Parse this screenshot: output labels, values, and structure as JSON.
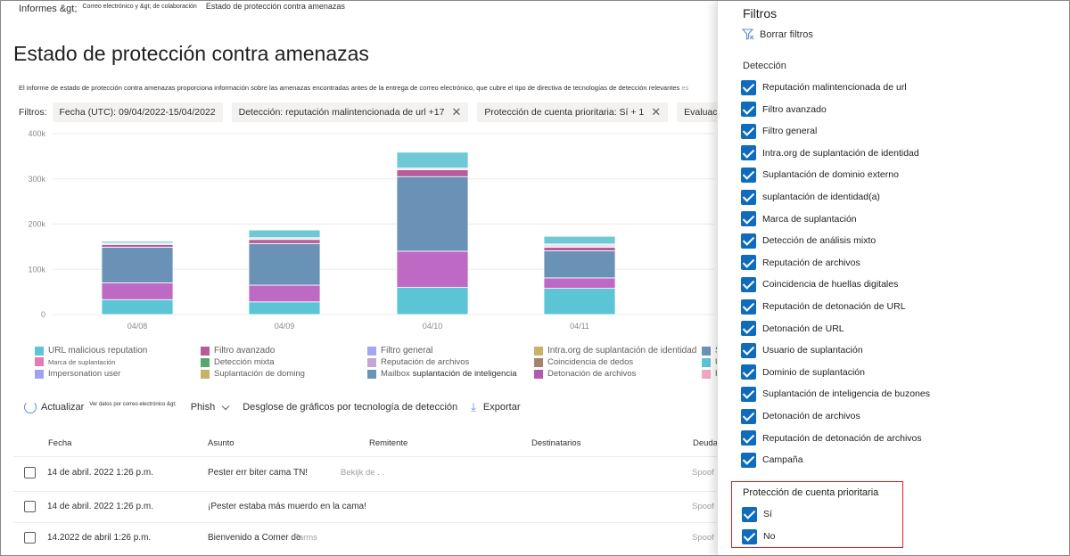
{
  "breadcrumb": {
    "item1": "Informes &gt;",
    "item2": "Correo electrónico y &gt; de colaboración",
    "item3": "Estado de protección contra amenazas"
  },
  "page_title": "Estado de protección contra amenazas",
  "description": {
    "text": "El informe de estado de protección contra amenazas proporciona información sobre las amenazas encontradas antes de la entrega de correo electrónico, que cubre el tipo de directiva de tecnologías de detección relevantes",
    "fade": "es"
  },
  "filters": {
    "label": "Filtros:",
    "chips": [
      {
        "text": "Fecha (UTC): 09/04/2022-15/04/2022"
      },
      {
        "text": "Detección: reputación malintencionada de url +17"
      },
      {
        "text": "Protección de cuenta prioritaria: Sí + 1"
      },
      {
        "text": "Evaluación: NO"
      }
    ]
  },
  "chart_data": {
    "type": "bar",
    "stacked": true,
    "categories": [
      "04/08",
      "04/09",
      "04/10",
      "04/11"
    ],
    "y_ticks": [
      "0",
      "100k",
      "200k",
      "300k",
      "400k"
    ],
    "ylim": [
      0,
      400000
    ],
    "series": [
      {
        "name": "URL malicious reputation",
        "color": "#5bc5d6",
        "values": [
          33000,
          28000,
          60000,
          58000
        ]
      },
      {
        "name": "Filtro avanzado",
        "color": "#be69c4",
        "values": [
          37000,
          37000,
          80000,
          23000
        ]
      },
      {
        "name": "Impersonation user",
        "color": "#6a92b7",
        "values": [
          79000,
          92000,
          165000,
          60000
        ]
      },
      {
        "name": "Marca de suplantación",
        "color": "#b85b9a",
        "values": [
          6000,
          9000,
          15000,
          8000
        ]
      },
      {
        "name": "Filtro general",
        "color": "#ece3f0",
        "values": [
          3000,
          4000,
          4000,
          7000
        ]
      },
      {
        "name": "Suplantación de dominio",
        "color": "#6ec8d5",
        "values": [
          4000,
          17000,
          35000,
          17000
        ]
      }
    ]
  },
  "legend": [
    {
      "label": "URL malicious reputation",
      "color": "#5bc5d6"
    },
    {
      "label": "Filtro avanzado",
      "color": "#b85b9a"
    },
    {
      "label": "Filtro general",
      "color": "#a3a6f2"
    },
    {
      "label": "Intra.org de suplantación de identidad",
      "color": "#c9b16a"
    },
    {
      "label": "Marca de suplantación",
      "color": "#e67ab6"
    },
    {
      "label": "Detección mixta",
      "color": "#55a86a"
    },
    {
      "label": "Reputación de archivos",
      "color": "#c3a6d6"
    },
    {
      "label": "Coincidencia de dedos",
      "color": "#a5836b"
    },
    {
      "label": "Impersonation user",
      "color": "#9fa2f0"
    },
    {
      "label": "Suplantación de doming",
      "color": "#c9b16a"
    },
    {
      "label": "Mailbox",
      "label2": "suplantación de inteligencia",
      "color": "#6a92b7"
    },
    {
      "label": "Detonación de archivos",
      "color": "#b05bb0"
    },
    {
      "label": "S",
      "color": "#6a92b7"
    },
    {
      "label": "U",
      "color": "#5bc5d6"
    },
    {
      "label": "F",
      "color": "#f0a8c4"
    }
  ],
  "toolbar": {
    "refresh": "Actualizar",
    "view_data": "Ver datos por correo electrónico &gt;",
    "phish": "Phish",
    "breakdown": "Desglose de gráficos por tecnología de detección",
    "export": "Exportar"
  },
  "table": {
    "headers": [
      "Fecha",
      "Asunto",
      "Remitente",
      "Destinatarios",
      "Deuda"
    ],
    "rows": [
      {
        "date": "14 de abril. 2022 1:26 p.m.",
        "subject": "Pester err biter cama TN!",
        "subject_faded": "Bekijk de . .",
        "threat": "Spoof"
      },
      {
        "date": "14 de abril. 2022 1:26 p.m.",
        "subject": "¡Pester estaba más muerdo en la cama!",
        "subject_faded": "",
        "threat": "Spoof"
      },
      {
        "date": "14.2022 de abril 1:26 p.m.",
        "subject": "Bienvenido a Comer de",
        "subject_faded": "Farms",
        "threat": "Spoof"
      }
    ]
  },
  "panel": {
    "title": "Filtros",
    "clear": "Borrar filtros",
    "detection_label": "Detección",
    "detection_items": [
      "Reputación malintencionada de url",
      "Filtro avanzado",
      "Filtro general",
      "Intra.org de suplantación de identidad",
      "Suplantación de dominio externo",
      "suplantación de identidad(a)",
      "Marca de suplantación",
      "Detección de análisis mixto",
      "Reputación de archivos",
      "Coincidencia de huellas digitales",
      "Reputación de detonación de URL",
      "Detonación de URL",
      "Usuario de suplantación",
      "Dominio de suplantación",
      "Suplantación de inteligencia de buzones",
      "Detonación de archivos",
      "Reputación de detonación de archivos",
      "Campaña"
    ],
    "priority_label": "Protección de cuenta prioritaria",
    "priority_items": [
      "Sí",
      "No"
    ]
  }
}
